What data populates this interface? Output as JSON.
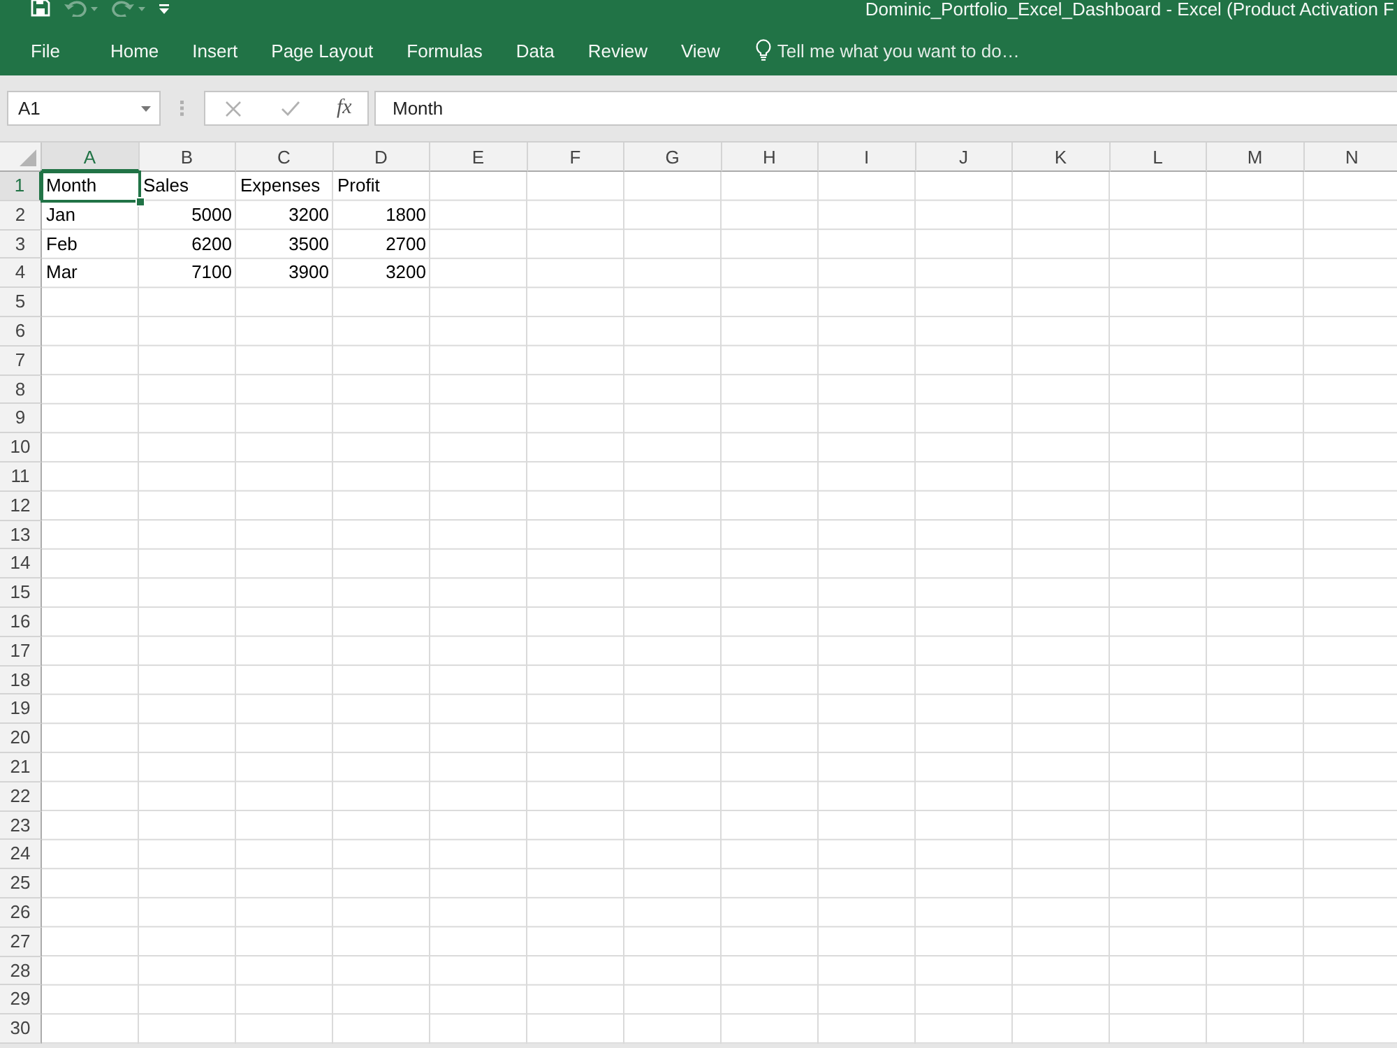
{
  "title_bar": {
    "quick_access": [
      {
        "kind": "save",
        "disabled": false
      },
      {
        "kind": "undo",
        "disabled": true
      },
      {
        "kind": "redo",
        "disabled": true
      },
      {
        "kind": "customize",
        "disabled": false
      }
    ],
    "title": "Dominic_Portfolio_Excel_Dashboard - Excel (Product Activation F"
  },
  "ribbon": {
    "tabs": [
      {
        "label": "File",
        "selected": false
      },
      {
        "label": "Home",
        "selected": false
      },
      {
        "label": "Insert",
        "selected": false
      },
      {
        "label": "Page Layout",
        "selected": false
      },
      {
        "label": "Formulas",
        "selected": false
      },
      {
        "label": "Data",
        "selected": false
      },
      {
        "label": "Review",
        "selected": false
      },
      {
        "label": "View",
        "selected": false
      }
    ],
    "tell_me": {
      "placeholder": "Tell me what you want to do…"
    }
  },
  "formula_bar": {
    "name_box": "A1",
    "buttons": [
      {
        "kind": "cancel",
        "disabled": true
      },
      {
        "kind": "enter",
        "disabled": true
      },
      {
        "kind": "function",
        "label": "fx",
        "disabled": false
      }
    ],
    "formula": "Month"
  },
  "sheet": {
    "columns": [
      {
        "label": "A",
        "selected": true
      },
      {
        "label": "B",
        "selected": false
      },
      {
        "label": "C",
        "selected": false
      },
      {
        "label": "D",
        "selected": false
      },
      {
        "label": "E",
        "selected": false
      },
      {
        "label": "F",
        "selected": false
      },
      {
        "label": "G",
        "selected": false
      },
      {
        "label": "H",
        "selected": false
      },
      {
        "label": "I",
        "selected": false
      },
      {
        "label": "J",
        "selected": false
      },
      {
        "label": "K",
        "selected": false
      },
      {
        "label": "L",
        "selected": false
      },
      {
        "label": "M",
        "selected": false
      },
      {
        "label": "N",
        "selected": false
      }
    ],
    "rows": [
      {
        "number": "1",
        "selected": true,
        "cells": [
          {
            "kind": "text",
            "text": "Month",
            "selected": true
          },
          {
            "kind": "text",
            "text": "Sales",
            "selected": false
          },
          {
            "kind": "text",
            "text": "Expenses",
            "selected": false
          },
          {
            "kind": "text",
            "text": "Profit",
            "selected": false
          }
        ]
      },
      {
        "number": "2",
        "selected": false,
        "cells": [
          {
            "kind": "text",
            "text": "Jan",
            "selected": false
          },
          {
            "kind": "number",
            "text": "5000",
            "selected": false
          },
          {
            "kind": "number",
            "text": "3200",
            "selected": false
          },
          {
            "kind": "number",
            "text": "1800",
            "selected": false
          }
        ]
      },
      {
        "number": "3",
        "selected": false,
        "cells": [
          {
            "kind": "text",
            "text": "Feb",
            "selected": false
          },
          {
            "kind": "number",
            "text": "6200",
            "selected": false
          },
          {
            "kind": "number",
            "text": "3500",
            "selected": false
          },
          {
            "kind": "number",
            "text": "2700",
            "selected": false
          }
        ]
      },
      {
        "number": "4",
        "selected": false,
        "cells": [
          {
            "kind": "text",
            "text": "Mar",
            "selected": false
          },
          {
            "kind": "number",
            "text": "7100",
            "selected": false
          },
          {
            "kind": "number",
            "text": "3900",
            "selected": false
          },
          {
            "kind": "number",
            "text": "3200",
            "selected": false
          }
        ]
      },
      {
        "number": "5",
        "selected": false
      },
      {
        "number": "6",
        "selected": false
      },
      {
        "number": "7",
        "selected": false
      },
      {
        "number": "8",
        "selected": false
      },
      {
        "number": "9",
        "selected": false
      },
      {
        "number": "10",
        "selected": false
      },
      {
        "number": "11",
        "selected": false
      },
      {
        "number": "12",
        "selected": false
      },
      {
        "number": "13",
        "selected": false
      },
      {
        "number": "14",
        "selected": false
      },
      {
        "number": "15",
        "selected": false
      },
      {
        "number": "16",
        "selected": false
      },
      {
        "number": "17",
        "selected": false
      },
      {
        "number": "18",
        "selected": false
      },
      {
        "number": "19",
        "selected": false
      },
      {
        "number": "20",
        "selected": false
      },
      {
        "number": "21",
        "selected": false
      },
      {
        "number": "22",
        "selected": false
      },
      {
        "number": "23",
        "selected": false
      },
      {
        "number": "24",
        "selected": false
      },
      {
        "number": "25",
        "selected": false
      },
      {
        "number": "26",
        "selected": false
      },
      {
        "number": "27",
        "selected": false
      },
      {
        "number": "28",
        "selected": false
      },
      {
        "number": "29",
        "selected": false
      },
      {
        "number": "30",
        "selected": false
      }
    ]
  }
}
